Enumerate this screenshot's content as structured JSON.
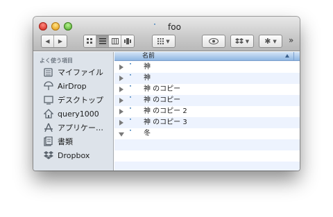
{
  "window": {
    "title": "foo"
  },
  "toolbar": {
    "back_glyph": "◀",
    "forward_glyph": "▶",
    "overflow_glyph": "»"
  },
  "sidebar": {
    "header": "よく使う項目",
    "items": [
      {
        "label": "マイファイル",
        "icon": "all-my-files-icon"
      },
      {
        "label": "AirDrop",
        "icon": "airdrop-icon"
      },
      {
        "label": "デスクトップ",
        "icon": "desktop-icon"
      },
      {
        "label": "query1000",
        "icon": "home-icon"
      },
      {
        "label": "アプリケー…",
        "icon": "applications-icon"
      },
      {
        "label": "書類",
        "icon": "documents-icon"
      },
      {
        "label": "Dropbox",
        "icon": "dropbox-icon"
      }
    ]
  },
  "list": {
    "column_name": "名前",
    "rows": [
      {
        "name": "神",
        "expanded": false
      },
      {
        "name": "神",
        "expanded": false
      },
      {
        "name": "神 のコピー",
        "expanded": false
      },
      {
        "name": "神 のコピー",
        "expanded": false
      },
      {
        "name": "神 のコピー 2",
        "expanded": false
      },
      {
        "name": "神 のコピー 3",
        "expanded": false
      },
      {
        "name": "冬",
        "expanded": true
      }
    ]
  },
  "colors": {
    "sidebar_bg": "#dde3ea",
    "header_selected": "#8fb6e3",
    "row_alt": "#edf3fe"
  }
}
